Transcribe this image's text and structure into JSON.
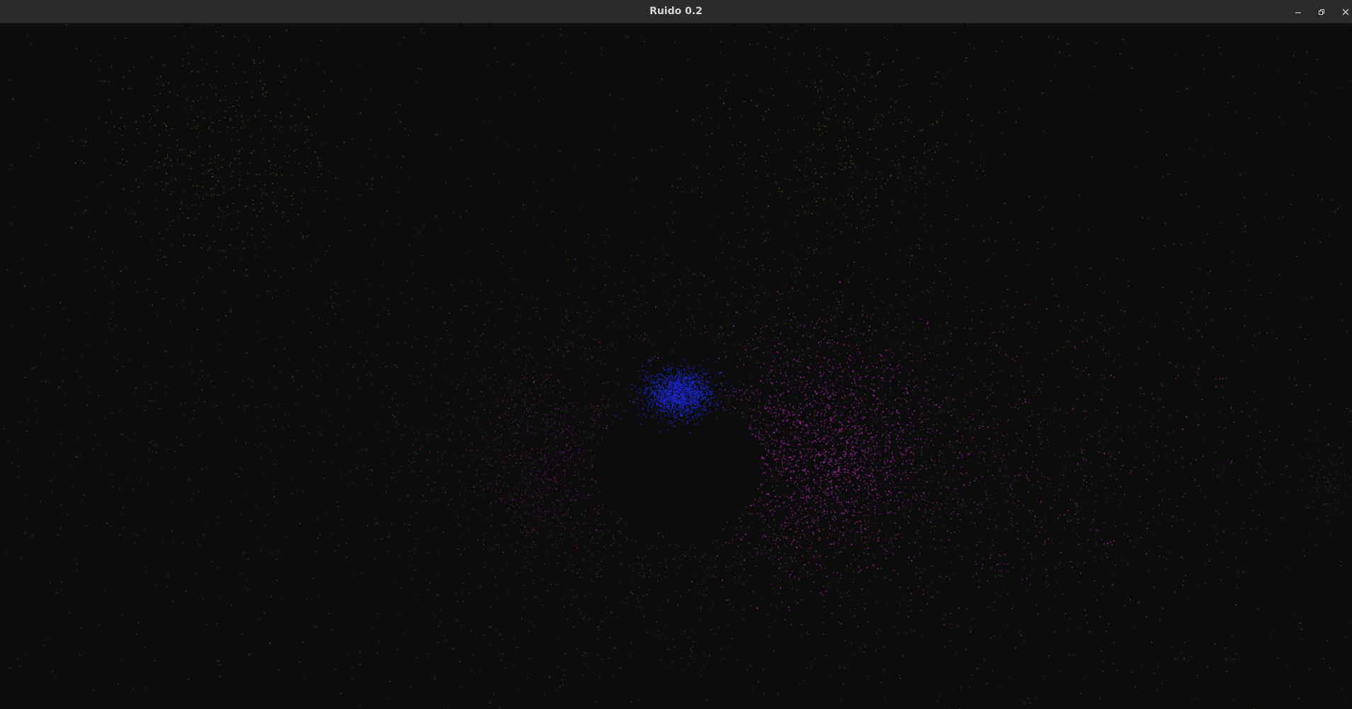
{
  "window": {
    "title": "Ruido 0.2",
    "background": "#0d0d0d",
    "titlebar_color": "#2b2b2b",
    "title_color": "#d6d6d6",
    "controls": [
      "minimize-icon",
      "restore-icon",
      "close-icon"
    ]
  },
  "scene": {
    "particle_colors": {
      "yellow": "#b8c23a",
      "magenta": "#d23ad2",
      "blue": "#1e2ad8"
    }
  }
}
